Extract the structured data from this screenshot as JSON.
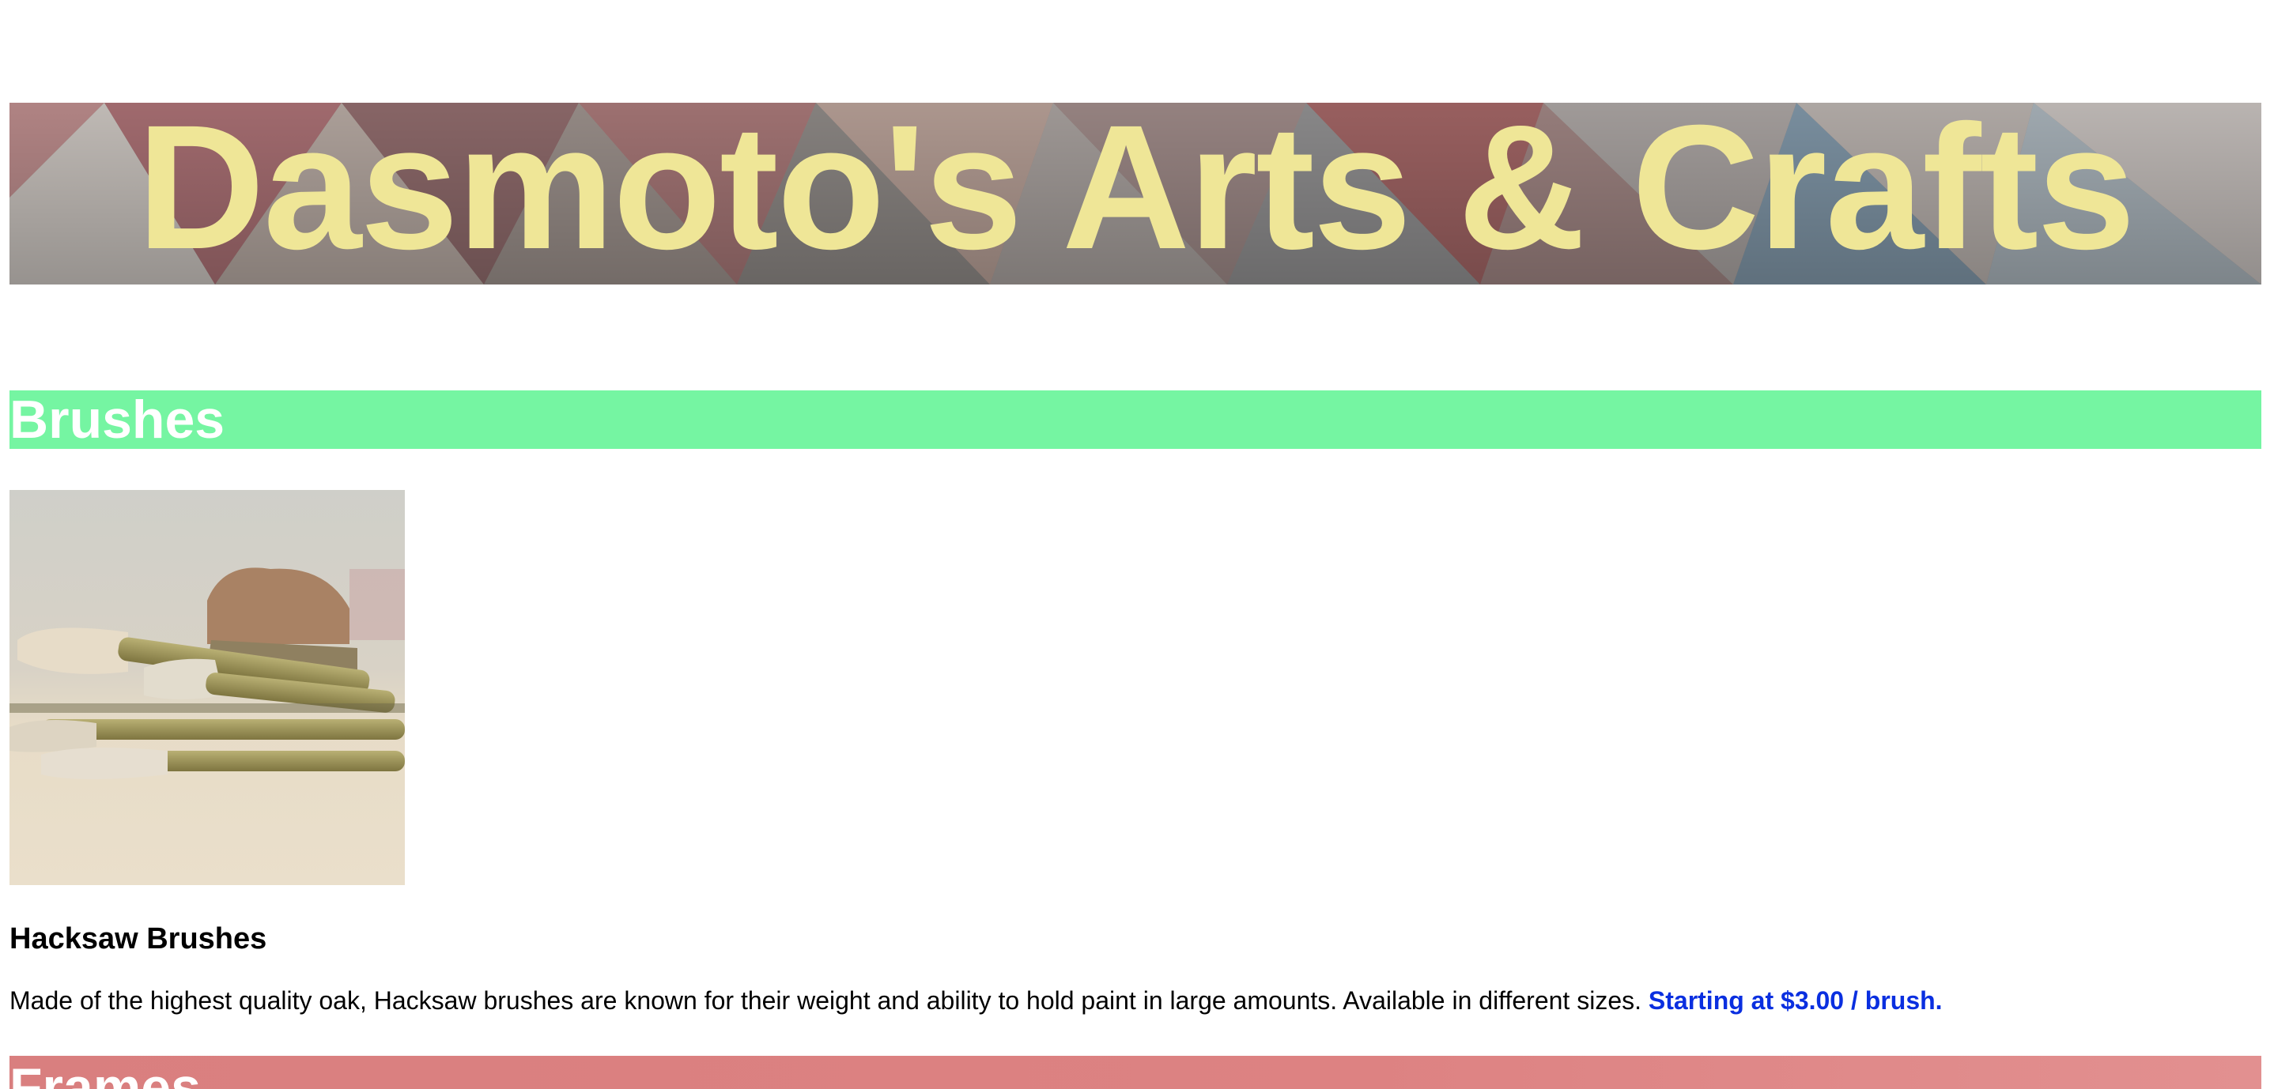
{
  "banner": {
    "title": "Dasmoto's Arts & Crafts"
  },
  "sections": {
    "brushes": {
      "heading": "Brushes",
      "product": {
        "image_name": "hacksaw-brushes-photo",
        "title": "Hacksaw Brushes",
        "description": "Made of the highest quality oak, Hacksaw brushes are known for their weight and ability to hold paint in large amounts. Available in different sizes.",
        "price": "Starting at $3.00 / brush."
      }
    },
    "frames": {
      "heading": "Frames"
    }
  },
  "colors": {
    "banner_text": "#efe697",
    "brushes_header_bg": "#75f5a2",
    "frames_header_bg": "#d97f7f",
    "price_text": "#0a2fe0",
    "header_text": "#ffffff"
  }
}
